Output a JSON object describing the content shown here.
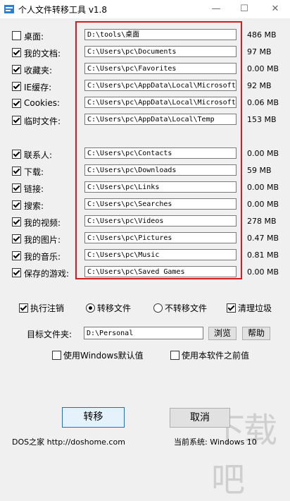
{
  "window": {
    "title": "个人文件转移工具 v1.8",
    "min_label": "—",
    "max_label": "☐",
    "close_label": "✕"
  },
  "folders": [
    {
      "label": "桌面:",
      "checked": false,
      "path": "D:\\tools\\桌面",
      "size": "486 MB"
    },
    {
      "label": "我的文档:",
      "checked": true,
      "path": "C:\\Users\\pc\\Documents",
      "size": "97 MB"
    },
    {
      "label": "收藏夹:",
      "checked": true,
      "path": "C:\\Users\\pc\\Favorites",
      "size": "0.00 MB"
    },
    {
      "label": "IE缓存:",
      "checked": true,
      "path": "C:\\Users\\pc\\AppData\\Local\\Microsoft\\",
      "size": "92 MB"
    },
    {
      "label": "Cookies:",
      "checked": true,
      "path": "C:\\Users\\pc\\AppData\\Local\\Microsoft\\",
      "size": "0.06 MB"
    },
    {
      "label": "临时文件:",
      "checked": true,
      "path": "C:\\Users\\pc\\AppData\\Local\\Temp",
      "size": "153 MB"
    },
    {
      "label": "联系人:",
      "checked": true,
      "path": "C:\\Users\\pc\\Contacts",
      "size": "0.00 MB"
    },
    {
      "label": "下载:",
      "checked": true,
      "path": "C:\\Users\\pc\\Downloads",
      "size": "59 MB"
    },
    {
      "label": "链接:",
      "checked": true,
      "path": "C:\\Users\\pc\\Links",
      "size": "0.00 MB"
    },
    {
      "label": "搜索:",
      "checked": true,
      "path": "C:\\Users\\pc\\Searches",
      "size": "0.00 MB"
    },
    {
      "label": "我的视频:",
      "checked": true,
      "path": "C:\\Users\\pc\\Videos",
      "size": "278 MB"
    },
    {
      "label": "我的图片:",
      "checked": true,
      "path": "C:\\Users\\pc\\Pictures",
      "size": "0.47 MB"
    },
    {
      "label": "我的音乐:",
      "checked": true,
      "path": "C:\\Users\\pc\\Music",
      "size": "0.81 MB"
    },
    {
      "label": "保存的游戏:",
      "checked": true,
      "path": "C:\\Users\\pc\\Saved Games",
      "size": "0.00 MB"
    }
  ],
  "options": {
    "execute_logoff": "执行注销",
    "transfer_files": "转移文件",
    "no_transfer_files": "不转移文件",
    "clean_junk": "清理垃圾"
  },
  "target": {
    "label": "目标文件夹:",
    "value": "D:\\Personal",
    "browse_label": "浏览",
    "help_label": "帮助"
  },
  "defaults": {
    "use_windows_default": "使用Windows默认值",
    "use_previous": "使用本软件之前值"
  },
  "actions": {
    "transfer_label": "转移",
    "cancel_label": "取消"
  },
  "footer": {
    "site": "DOS之家 http://doshome.com",
    "system": "当前系统: Windows 10"
  },
  "watermark": "下载吧",
  "colors": {
    "highlight_box": "#d21e1e",
    "primary_button_border": "#0078d7"
  }
}
